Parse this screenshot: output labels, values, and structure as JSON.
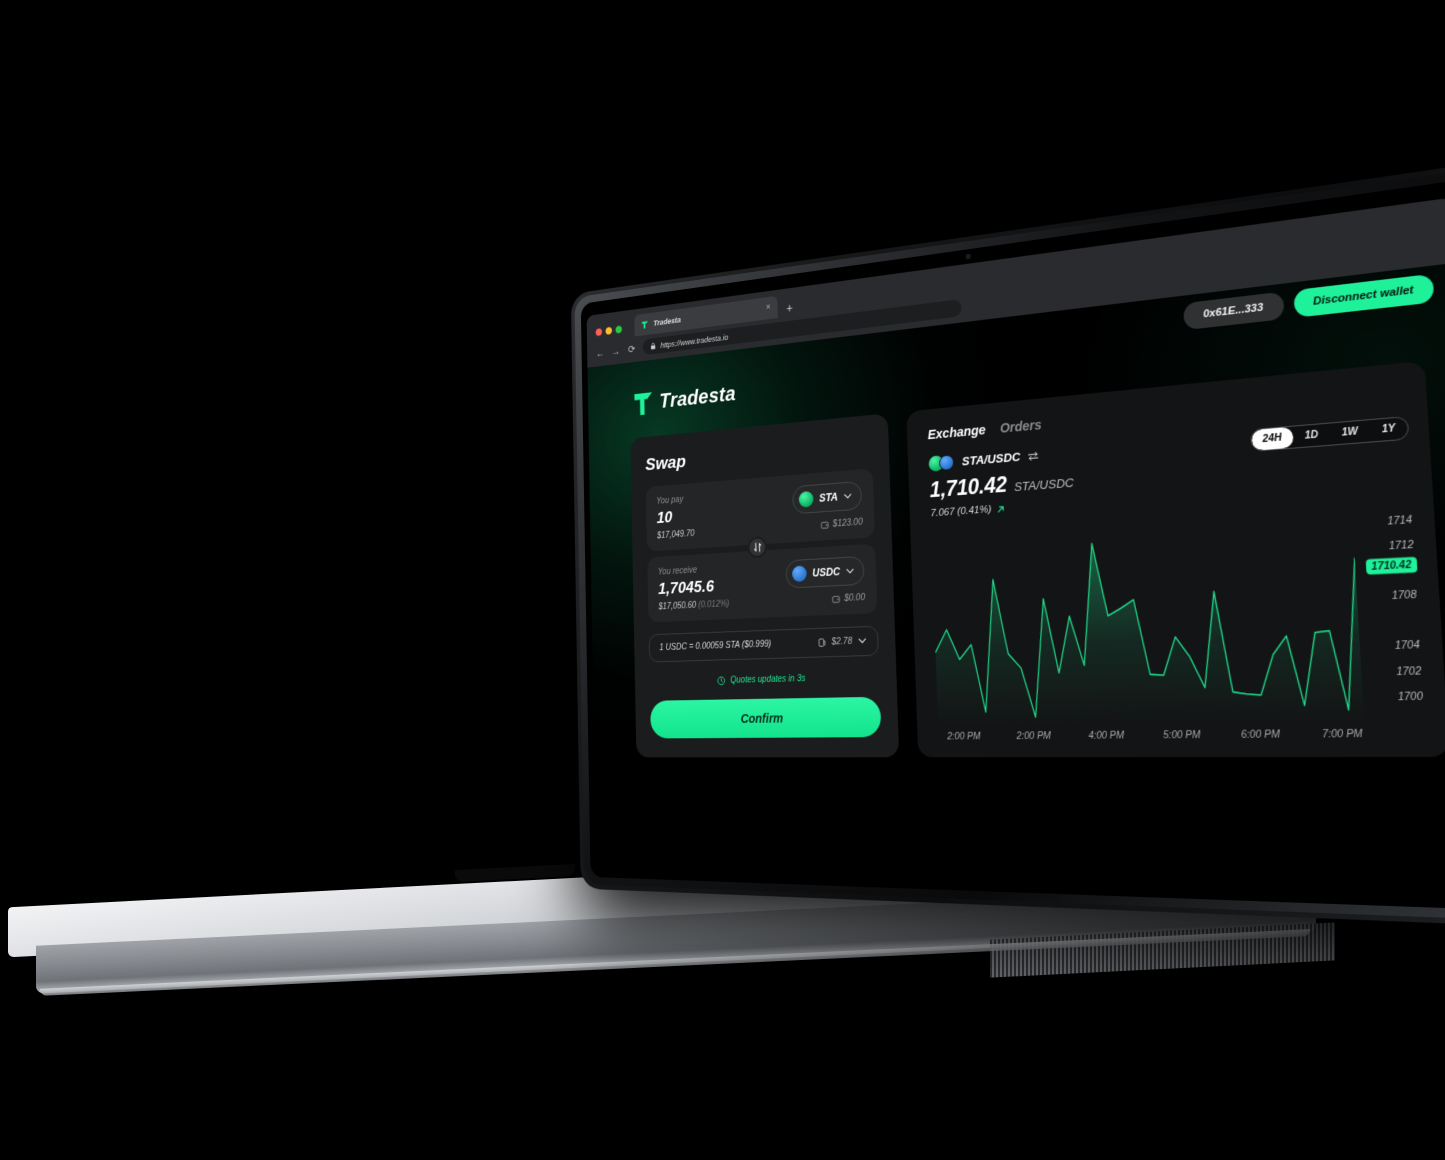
{
  "browser": {
    "tab_title": "Tradesta",
    "tab_close": "×",
    "new_tab": "+",
    "back": "←",
    "forward": "→",
    "reload": "⟳",
    "url": "https://www.tradesta.io"
  },
  "brand": {
    "name": "Tradesta"
  },
  "topbar": {
    "wallet_address": "0x61E...333",
    "disconnect_label": "Disconnect wallet"
  },
  "swap": {
    "title": "Swap",
    "pay": {
      "label": "You pay",
      "amount": "10",
      "usd": "$17,049.70",
      "token": "STA",
      "balance": "$123.00"
    },
    "receive": {
      "label": "You receive",
      "amount": "1,7045.6",
      "usd": "$17,050.60",
      "pct": "(0.012%)",
      "token": "USDC",
      "balance": "$0.00"
    },
    "rate_text": "1 USDC = 0.00059 STA ($0.999)",
    "gas": "$2.78",
    "quotes_text": "Quotes updates in 3s",
    "confirm_label": "Confirm"
  },
  "exchange": {
    "tabs": [
      {
        "label": "Exchange",
        "active": true
      },
      {
        "label": "Orders",
        "active": false
      }
    ],
    "pair": "STA/USDC",
    "price": "1,710.42",
    "price_unit": "STA/USDC",
    "change": "7.067 (0.41%)",
    "timeframes": [
      {
        "label": "24H",
        "active": true
      },
      {
        "label": "1D",
        "active": false
      },
      {
        "label": "1W",
        "active": false
      },
      {
        "label": "1Y",
        "active": false
      }
    ]
  },
  "colors": {
    "accent": "#1ff09a",
    "panel": "#1b1c1d",
    "panel_dark": "#131415",
    "card": "#242526",
    "usdc_blue": "#2775ca"
  },
  "chart_data": {
    "type": "line",
    "title": "STA/USDC 24H price",
    "xlabel": "",
    "ylabel": "",
    "grid": false,
    "legend": "none",
    "ylim": [
      1698,
      1715.5
    ],
    "yticks": [
      1714,
      1712,
      1710.42,
      1708,
      1704,
      1702,
      1700
    ],
    "current_value_label": "1710.42",
    "xticks": [
      "2:00 PM",
      "2:00 PM",
      "4:00 PM",
      "5:00 PM",
      "6:00 PM",
      "7:00 PM"
    ],
    "series": [
      {
        "name": "STA/USDC",
        "color": "#1fe08f",
        "values": [
          1704.6,
          1706.6,
          1703.9,
          1705.2,
          1699.2,
          1710.9,
          1704.3,
          1703.0,
          1698.7,
          1709.0,
          1702.5,
          1707.4,
          1703.1,
          1713.6,
          1707.3,
          1707.9,
          1708.6,
          1702.2,
          1702.1,
          1705.3,
          1703.6,
          1701.0,
          1709.0,
          1700.6,
          1700.4,
          1700.3,
          1703.6,
          1705.1,
          1699.4,
          1705.3,
          1705.4,
          1699.0,
          1711.2
        ]
      }
    ]
  }
}
